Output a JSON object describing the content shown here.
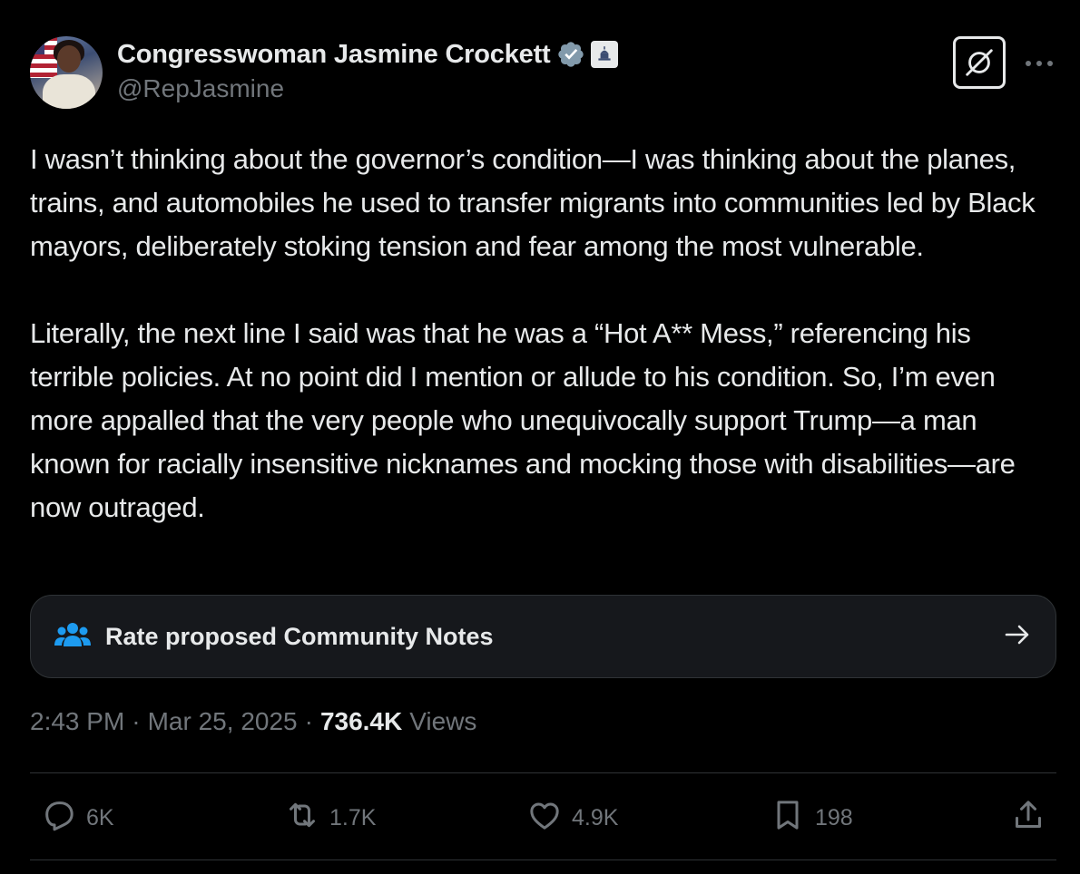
{
  "author": {
    "name": "Congresswoman Jasmine Crockett",
    "handle": "@RepJasmine"
  },
  "icons": {
    "verified": "verified-badge-icon",
    "government": "capitol-building-icon",
    "grok": "grok-icon",
    "more": "more-icon",
    "community": "community-notes-icon",
    "arrow": "arrow-right-icon",
    "reply": "reply-icon",
    "repost": "repost-icon",
    "like": "like-icon",
    "bookmark": "bookmark-icon",
    "share": "share-icon"
  },
  "tweet": {
    "paragraphs": [
      "I wasn’t thinking about the governor’s condition—I was thinking about the planes, trains, and automobiles he used to transfer migrants into communities led by Black mayors, deliberately stoking tension and fear among the most vulnerable.",
      "Literally, the next line I said was that he was a “Hot A** Mess,” referencing his terrible policies. At no point did I mention or allude to his condition. So, I’m even more appalled that the very people who unequivocally support Trump—a man known for racially insensitive nicknames and mocking those with disabilities—are now outraged."
    ]
  },
  "community_notes": {
    "label": "Rate proposed Community Notes"
  },
  "meta": {
    "time": "2:43 PM",
    "separator": "·",
    "date": "Mar 25, 2025",
    "views_count": "736.4K",
    "views_label": "Views"
  },
  "actions": {
    "replies": "6K",
    "reposts": "1.7K",
    "likes": "4.9K",
    "bookmarks": "198"
  },
  "colors": {
    "background": "#000000",
    "text": "#e7e9ea",
    "muted": "#71767b",
    "verified": "#1d9bf0",
    "border": "#2f3336"
  }
}
